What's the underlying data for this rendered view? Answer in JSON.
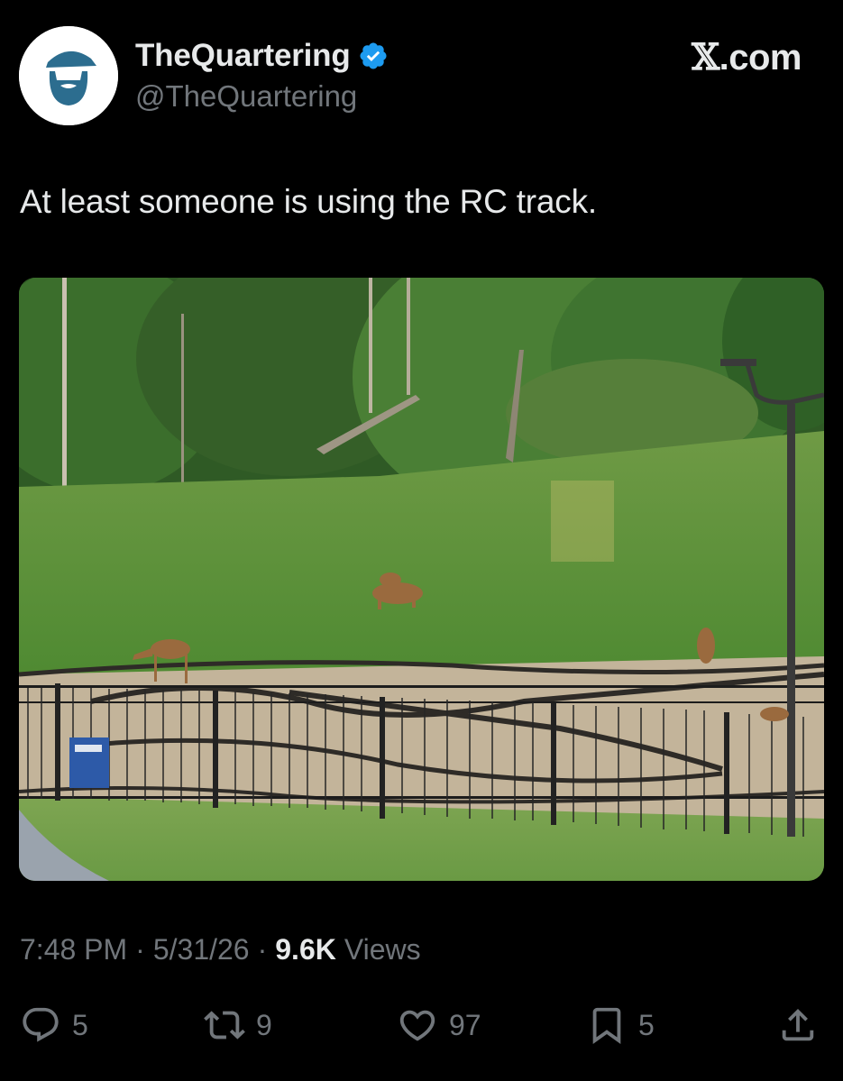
{
  "author": {
    "display_name": "TheQuartering",
    "handle": "@TheQuartering",
    "verified": true,
    "verified_color": "#1d9bf0",
    "avatar_icon": "bearded-man-logo"
  },
  "site": {
    "x_glyph": "𝕏",
    "suffix": ".com"
  },
  "tweet": {
    "text": "At least someone is using the RC track.",
    "media_icon": "photo-deer-rc-track"
  },
  "meta": {
    "time": "7:48 PM",
    "date": "5/31/26",
    "views_count": "9.6K",
    "views_label": "Views",
    "separator": "·"
  },
  "actions": {
    "replies": "5",
    "reposts": "9",
    "likes": "97",
    "bookmarks": "5"
  },
  "colors": {
    "background": "#000000",
    "primary_text": "#e7e9ea",
    "secondary_text": "#71767b",
    "accent": "#1d9bf0"
  }
}
